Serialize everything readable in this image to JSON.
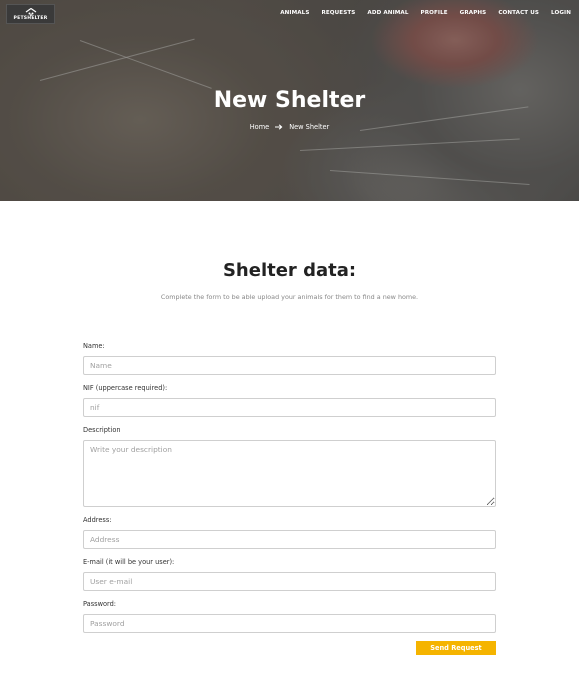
{
  "brand": {
    "logo_text": "PETSHELTER",
    "logo_icon": "paw-house-icon"
  },
  "nav": {
    "items": [
      {
        "label": "ANIMALS"
      },
      {
        "label": "REQUESTS"
      },
      {
        "label": "ADD ANIMAL"
      },
      {
        "label": "PROFILE"
      },
      {
        "label": "GRAPHS"
      },
      {
        "label": "CONTACT US"
      },
      {
        "label": "LOGIN"
      }
    ]
  },
  "hero": {
    "title": "New Shelter",
    "breadcrumb": {
      "home": "Home",
      "separator_icon": "arrow-right-icon",
      "current": "New Shelter"
    }
  },
  "form": {
    "title": "Shelter data:",
    "subtitle": "Complete the form to be able upload your animals for them to find a new home.",
    "fields": {
      "name": {
        "label": "Name:",
        "placeholder": "Name",
        "value": ""
      },
      "nif": {
        "label": "NIF (uppercase required):",
        "placeholder": "nif",
        "value": ""
      },
      "description": {
        "label": "Description",
        "placeholder": "Write your description",
        "value": ""
      },
      "address": {
        "label": "Address:",
        "placeholder": "Address",
        "value": ""
      },
      "email": {
        "label": "E-mail (it will be your user):",
        "placeholder": "User e-mail",
        "value": ""
      },
      "password": {
        "label": "Password:",
        "placeholder": "Password",
        "value": ""
      }
    },
    "submit_label": "Send Request"
  },
  "colors": {
    "accent": "#f5b400",
    "hero_overlay": "#333333",
    "text_dark": "#222222",
    "text_muted": "#888888"
  }
}
